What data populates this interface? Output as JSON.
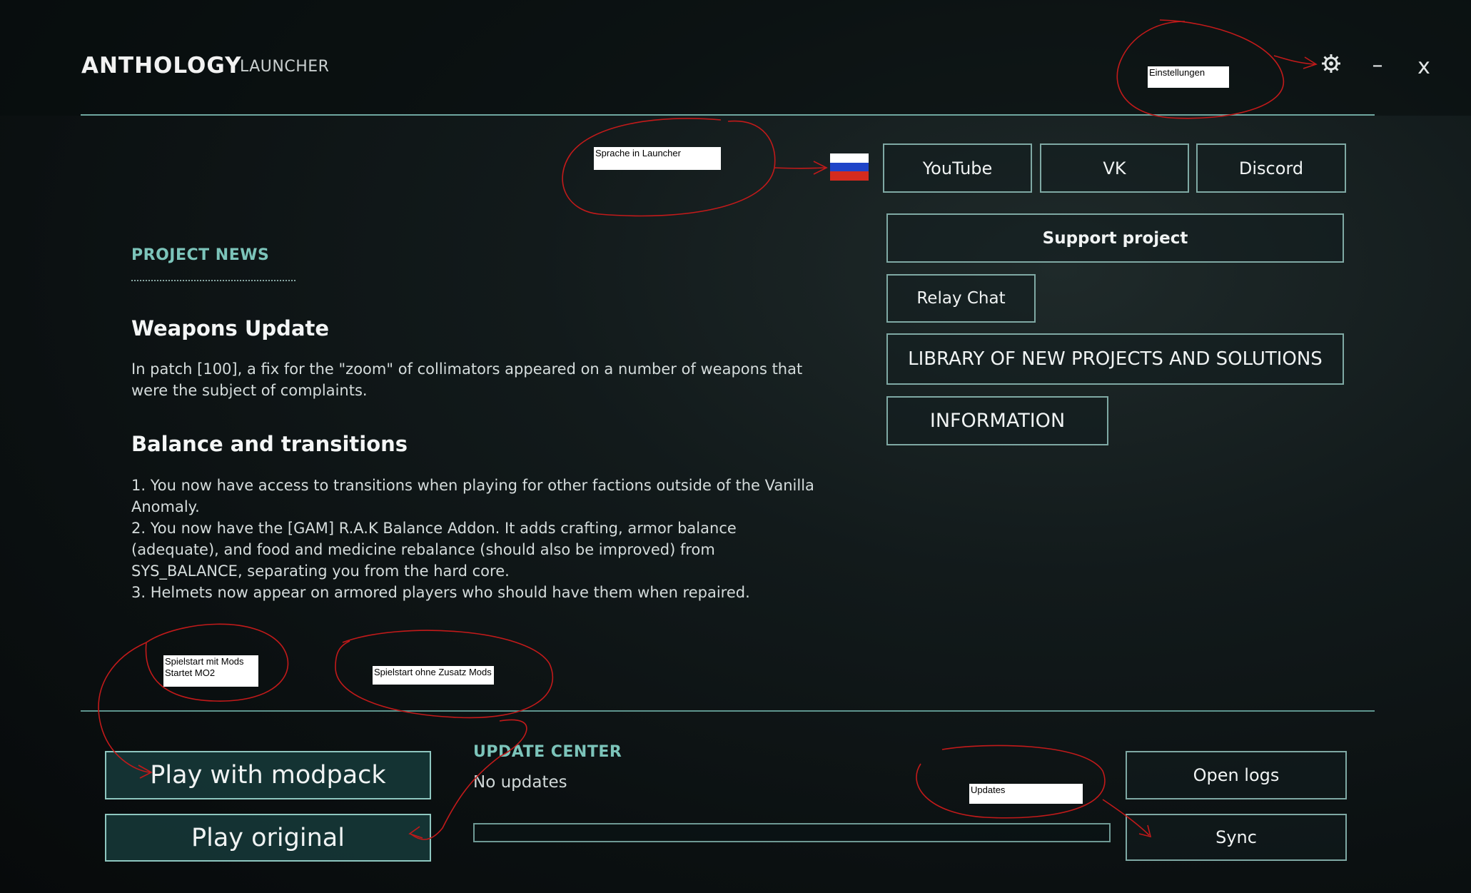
{
  "window": {
    "title": "ANTHOLOGY",
    "subtitle": "LAUNCHER",
    "settings_icon": "gear-icon",
    "minimize_label": "–",
    "close_label": "x"
  },
  "links": {
    "language_flag": "russian-flag-icon",
    "youtube": "YouTube",
    "vk": "VK",
    "discord": "Discord",
    "support": "Support project",
    "relay_chat": "Relay Chat",
    "library": "LIBRARY OF NEW PROJECTS AND SOLUTIONS",
    "information": "INFORMATION"
  },
  "news": {
    "heading": "PROJECT NEWS",
    "items": [
      {
        "title": "Weapons Update",
        "lines": [
          "In patch [100], a fix for the \"zoom\" of collimators appeared on a number of weapons that",
          "were the subject of complaints."
        ]
      },
      {
        "title": "Balance and transitions",
        "lines": [
          "1. You now have access to transitions when playing for other factions outside of the Vanilla",
          "Anomaly.",
          "2. You now have the [GAM] R.A.K Balance Addon. It adds crafting, armor balance",
          "(adequate), and food and medicine rebalance (should also be improved) from",
          "SYS_BALANCE, separating you from the hard core.",
          "3. Helmets now appear on armored players who should have them when repaired."
        ]
      }
    ]
  },
  "play": {
    "modpack": "Play with modpack",
    "original": "Play original"
  },
  "update_center": {
    "heading": "UPDATE CENTER",
    "status": "No updates",
    "progress": 0,
    "open_logs": "Open logs",
    "sync": "Sync"
  },
  "annotations": {
    "settings": "Einstellungen",
    "language": "Sprache in Launcher",
    "play_mods_line1": "Spielstart mit Mods",
    "play_mods_line2": "Startet MO2",
    "play_original": "Spielstart ohne Zusatz Mods",
    "updates": "Updates",
    "color": "#c21a1a"
  },
  "colors": {
    "accent": "#7cc4ba",
    "border": "#7fa9a4",
    "play_bg": "#163a39"
  }
}
